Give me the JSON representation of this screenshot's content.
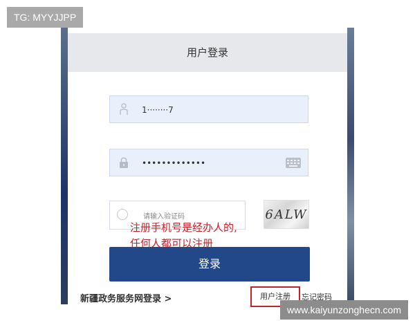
{
  "watermark_top": "TG: MYYJJPP",
  "watermark_bottom": "www.kaiyunzonghecn.com",
  "card": {
    "title": "用户登录",
    "username_value": "1········7",
    "password_value": "•••••••••••••",
    "captcha_placeholder": "请输入验证码",
    "captcha_image_text": "6ALW",
    "annotation_lines": [
      "注册手机号是经办人的,",
      "任何人都可以注册"
    ],
    "login_button": "登录",
    "footer_left": "新疆政务服务网登录 >",
    "register_link": "用户注册",
    "forgot_link": "忘记密码"
  },
  "colors": {
    "primary_button": "#22488a",
    "annotation_red": "#c8202a",
    "field_bg": "#e9f0fb"
  },
  "icons": [
    "person-icon",
    "lock-icon",
    "keyboard-icon",
    "check-circle-icon"
  ]
}
